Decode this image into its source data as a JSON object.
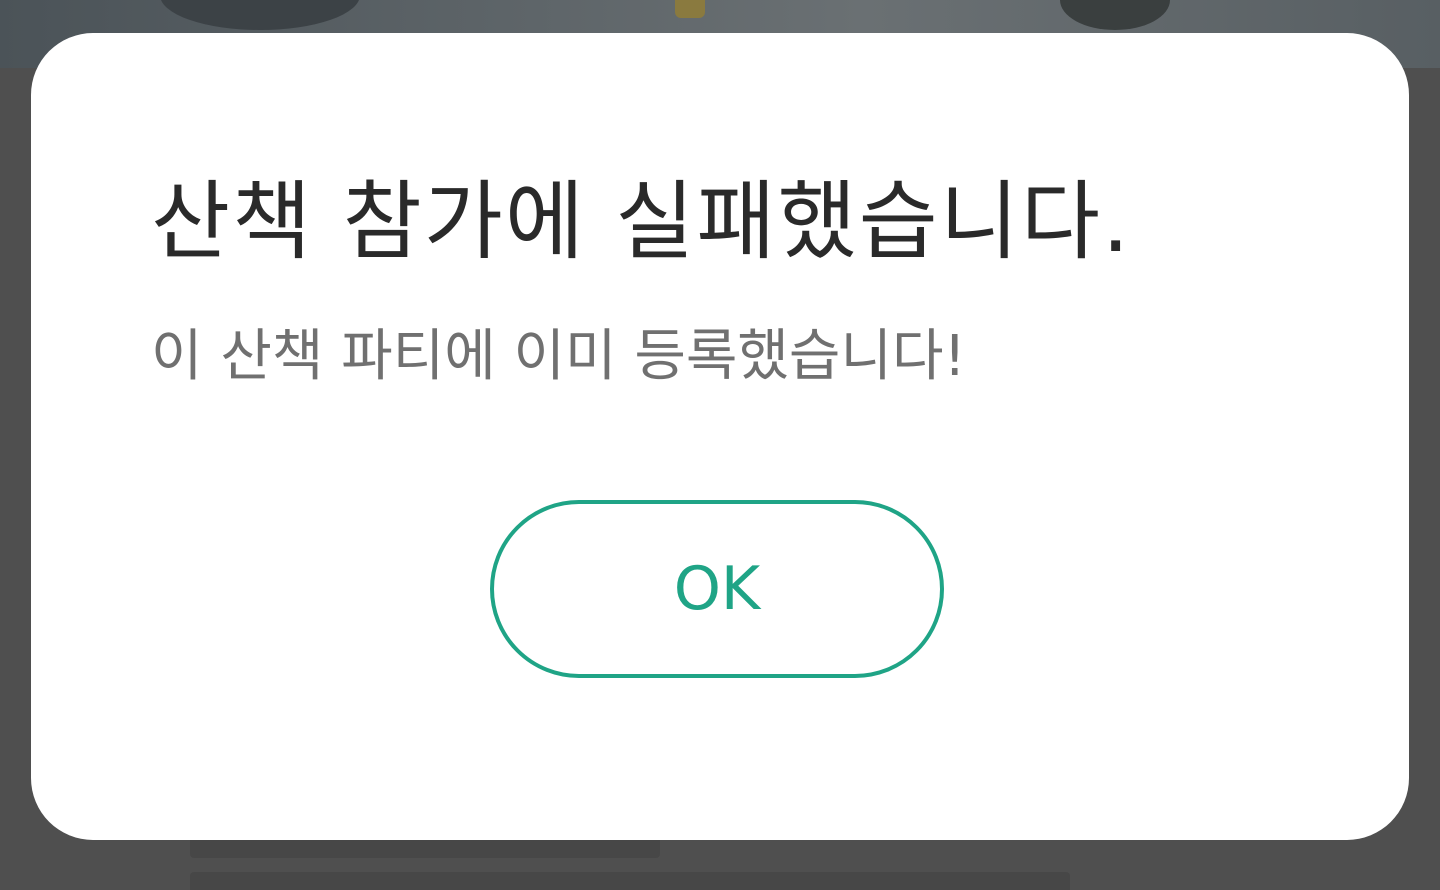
{
  "dialog": {
    "title": "산책 참가에 실패했습니다.",
    "message": "이 산책 파티에 이미 등록했습니다!",
    "ok_label": "OK"
  },
  "colors": {
    "accent": "#1fa486",
    "title_text": "#2a2a2a",
    "message_text": "#707070",
    "overlay": "#4f4f4f",
    "dialog_bg": "#ffffff"
  }
}
